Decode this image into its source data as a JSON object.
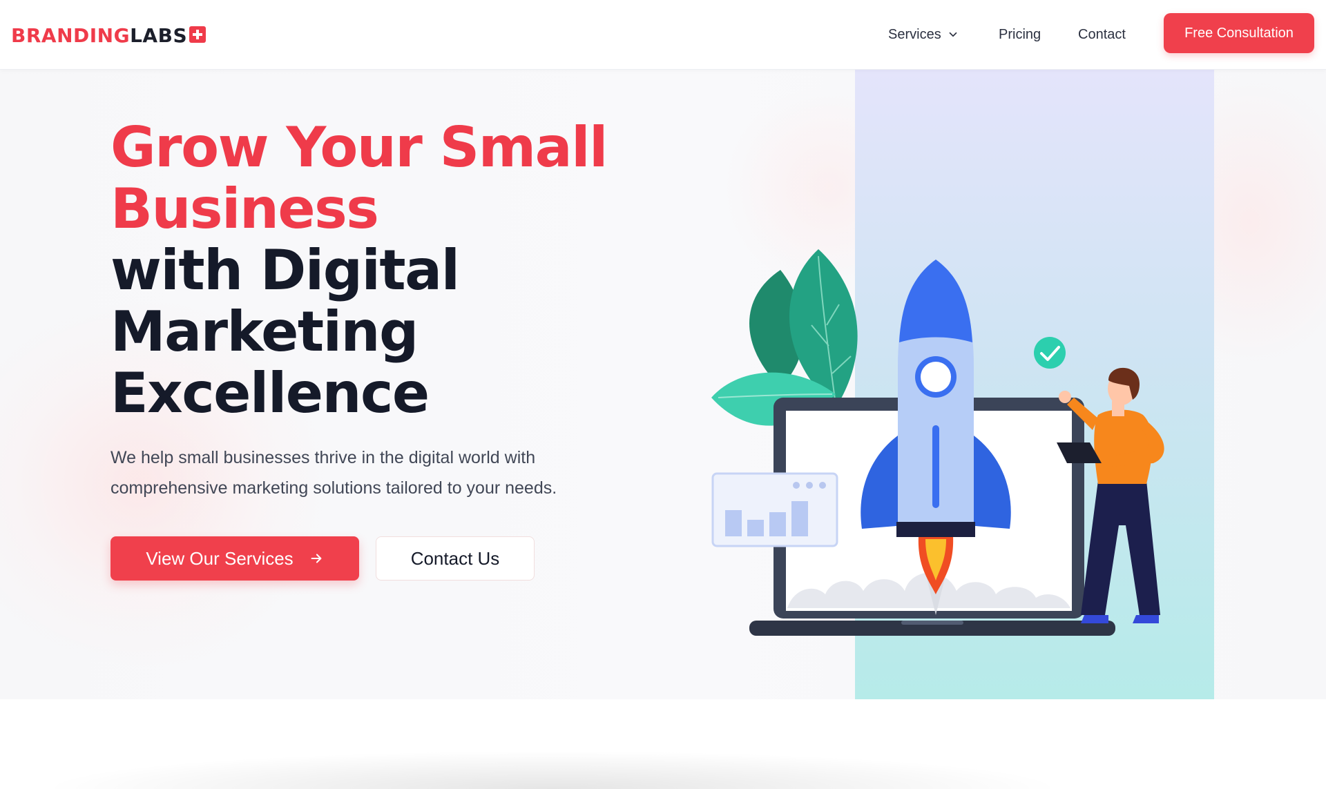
{
  "header": {
    "logo": {
      "brand": "BRANDING",
      "accent": "LABS",
      "icon": "plus-square-icon"
    },
    "nav": [
      {
        "label": "Services",
        "has_dropdown": true
      },
      {
        "label": "Pricing"
      },
      {
        "label": "Contact"
      }
    ],
    "cta_label": "Free Consultation"
  },
  "hero": {
    "title_red": [
      "Grow Your Small",
      "Business"
    ],
    "title_dark": [
      "with Digital",
      "Marketing",
      "Excellence"
    ],
    "subtitle": "We help small businesses thrive in the digital world with comprehensive marketing solutions tailored to your needs.",
    "primary_button": "View Our Services",
    "secondary_button": "Contact Us",
    "illustration": [
      "rocket-icon",
      "laptop-icon",
      "person-icon",
      "leaf-icon",
      "check-circle-icon",
      "bar-chart-icon"
    ]
  },
  "colors": {
    "accent": "#ef3b4a",
    "dark_text": "#151a29",
    "panel_top": "#e4e4fb",
    "panel_bottom": "#b6ebe9"
  }
}
